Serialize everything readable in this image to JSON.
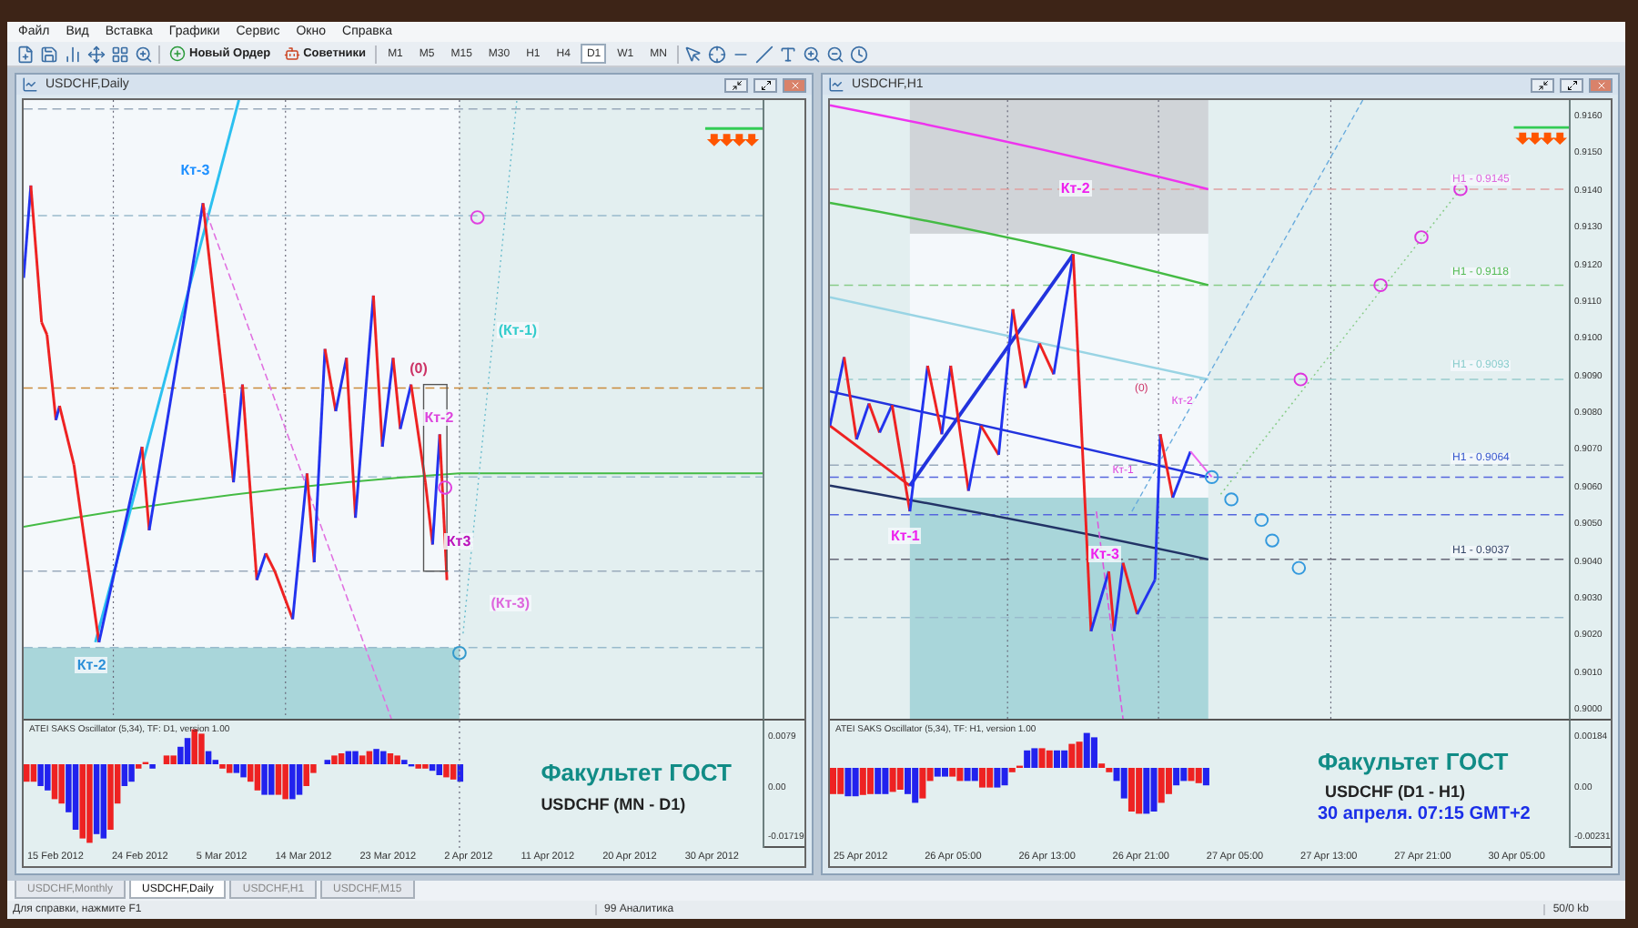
{
  "menu": [
    "Файл",
    "Вид",
    "Вставка",
    "Графики",
    "Сервис",
    "Окно",
    "Справка"
  ],
  "toolbar": {
    "buttons": [
      {
        "label": "Новый Ордер"
      },
      {
        "label": "Советники"
      }
    ],
    "timeframes": [
      {
        "label": "M1",
        "selected": false
      },
      {
        "label": "M5",
        "selected": false
      },
      {
        "label": "M15",
        "selected": false
      },
      {
        "label": "M30",
        "selected": false
      },
      {
        "label": "H1",
        "selected": false
      },
      {
        "label": "H4",
        "selected": false
      },
      {
        "label": "D1",
        "selected": true
      },
      {
        "label": "W1",
        "selected": false
      },
      {
        "label": "MN",
        "selected": false
      }
    ]
  },
  "charts": [
    {
      "title": "USDCHF,Daily",
      "labels": [
        {
          "text": "Кт-3",
          "color": "#1e90ff"
        },
        {
          "text": "(Кт-1)",
          "color": "#33cccc"
        },
        {
          "text": "(0)",
          "color": "#cc3366"
        },
        {
          "text": "Кт-2",
          "color": "#dd44dd"
        },
        {
          "text": "Кт3",
          "color": "#bb11bb"
        },
        {
          "text": "(Кт-3)",
          "color": "#dd66dd"
        },
        {
          "text": "Кт-2",
          "color": "#2a8fd8"
        }
      ],
      "oscillator": {
        "title": "ATEI SAKS Oscillator (5,34), TF: D1, version 1.00",
        "ticks": [
          "0.0079",
          "0.00",
          "-0.01719"
        ],
        "notes": [
          {
            "text": "Факультет ГОСТ",
            "kind": "brand"
          },
          {
            "text": "USDCHF (MN - D1)",
            "kind": "pair"
          }
        ]
      },
      "date_ticks": [
        "15 Feb 2012",
        "24 Feb 2012",
        "5 Mar 2012",
        "14 Mar 2012",
        "23 Mar 2012",
        "2 Apr 2012",
        "11 Apr 2012",
        "20 Apr 2012",
        "30 Apr 2012"
      ]
    },
    {
      "title": "USDCHF,H1",
      "price_ticks": [
        "0.9160",
        "0.9150",
        "0.9140",
        "0.9130",
        "0.9120",
        "0.9110",
        "0.9100",
        "0.9090",
        "0.9080",
        "0.9070",
        "0.9060",
        "0.9050",
        "0.9040",
        "0.9030",
        "0.9020",
        "0.9010",
        "0.9000"
      ],
      "labels": [
        {
          "text": "Кт-2",
          "color": "#ee22ee"
        },
        {
          "text": "(0)",
          "color": "#cc3366"
        },
        {
          "text": "Кт-2",
          "color": "#dd44dd"
        },
        {
          "text": "Кт-1",
          "color": "#dd44dd"
        },
        {
          "text": "Кт-1",
          "color": "#ee22ee"
        },
        {
          "text": "Кт-3",
          "color": "#ee22ee"
        },
        {
          "text": "H1 - 0.9145",
          "color": "#dd66dd"
        },
        {
          "text": "H1 - 0.9118",
          "color": "#55bb55"
        },
        {
          "text": "H1 - 0.9093",
          "color": "#88cccc"
        },
        {
          "text": "H1 - 0.9064",
          "color": "#3355cc"
        },
        {
          "text": "H1 - 0.9037",
          "color": "#334466"
        }
      ],
      "oscillator": {
        "title": "ATEI SAKS Oscillator (5,34), TF: H1, version 1.00",
        "ticks": [
          "0.00184",
          "0.00",
          "-0.00231"
        ],
        "notes": [
          {
            "text": "Факультет ГОСТ",
            "kind": "brand"
          },
          {
            "text": "USDCHF (D1 - H1)",
            "kind": "pair"
          },
          {
            "text": "30 апреля. 07:15 GMT+2",
            "kind": "time"
          }
        ]
      },
      "date_ticks": [
        "25 Apr 2012",
        "26 Apr 05:00",
        "26 Apr 13:00",
        "26 Apr 21:00",
        "27 Apr 05:00",
        "27 Apr 13:00",
        "27 Apr 21:00",
        "30 Apr 05:00"
      ]
    }
  ],
  "tabs": [
    {
      "label": "USDCHF,Monthly",
      "selected": false
    },
    {
      "label": "USDCHF,Daily",
      "selected": true
    },
    {
      "label": "USDCHF,H1",
      "selected": false
    },
    {
      "label": "USDCHF,M15",
      "selected": false
    }
  ],
  "status_bar": {
    "hint": "Для справки, нажмите F1",
    "profile": "99 Аналитика",
    "traffic": "50/0 kb"
  }
}
